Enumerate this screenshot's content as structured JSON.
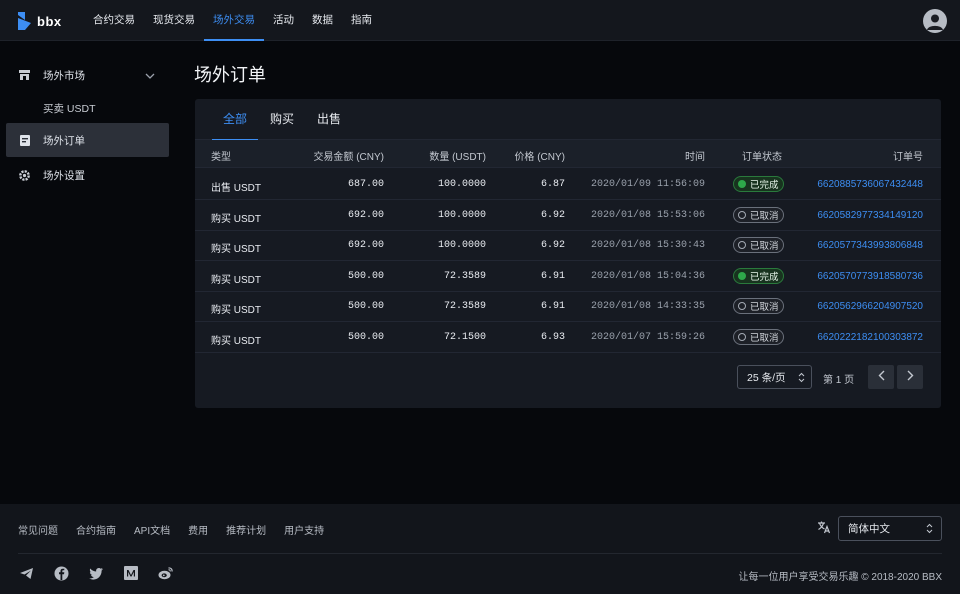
{
  "brand": {
    "name": "bbx"
  },
  "nav": {
    "items": [
      "合约交易",
      "现货交易",
      "场外交易",
      "活动",
      "数据",
      "指南"
    ],
    "active": "场外交易"
  },
  "sidebar": {
    "market_label": "场外市场",
    "market_sub": "买卖 USDT",
    "orders_label": "场外订单",
    "settings_label": "场外设置"
  },
  "page": {
    "title": "场外订单"
  },
  "tabs": [
    "全部",
    "购买",
    "出售"
  ],
  "table": {
    "headers": {
      "type": "类型",
      "amount": "交易金额 (CNY)",
      "quantity": "数量 (USDT)",
      "price": "价格 (CNY)",
      "time": "时间",
      "status": "订单状态",
      "order_id": "订单号"
    },
    "rows": [
      {
        "type": "出售 USDT",
        "amount": "687.00",
        "quantity": "100.0000",
        "price": "6.87",
        "time": "2020/01/09 11:56:09",
        "status": "已完成",
        "order_id": "6620885736067432448"
      },
      {
        "type": "购买 USDT",
        "amount": "692.00",
        "quantity": "100.0000",
        "price": "6.92",
        "time": "2020/01/08 15:53:06",
        "status": "已取消",
        "order_id": "6620582977334149120"
      },
      {
        "type": "购买 USDT",
        "amount": "692.00",
        "quantity": "100.0000",
        "price": "6.92",
        "time": "2020/01/08 15:30:43",
        "status": "已取消",
        "order_id": "6620577343993806848"
      },
      {
        "type": "购买 USDT",
        "amount": "500.00",
        "quantity": "72.3589",
        "price": "6.91",
        "time": "2020/01/08 15:04:36",
        "status": "已完成",
        "order_id": "6620570773918580736"
      },
      {
        "type": "购买 USDT",
        "amount": "500.00",
        "quantity": "72.3589",
        "price": "6.91",
        "time": "2020/01/08 14:33:35",
        "status": "已取消",
        "order_id": "6620562966204907520"
      },
      {
        "type": "购买 USDT",
        "amount": "500.00",
        "quantity": "72.1500",
        "price": "6.93",
        "time": "2020/01/07 15:59:26",
        "status": "已取消",
        "order_id": "6620222182100303872"
      }
    ]
  },
  "pager": {
    "page_size": "25 条/页",
    "page_label": "第 1 页"
  },
  "footer": {
    "links": [
      "常见问题",
      "合约指南",
      "API文档",
      "费用",
      "推荐计划",
      "用户支持"
    ],
    "language": "简体中文",
    "copyright": "让每一位用户享受交易乐趣 © 2018-2020 BBX"
  },
  "colors": {
    "accent": "#3d8ef3",
    "done": "#2ea84a",
    "background": "#06080c",
    "card": "#161a22"
  }
}
